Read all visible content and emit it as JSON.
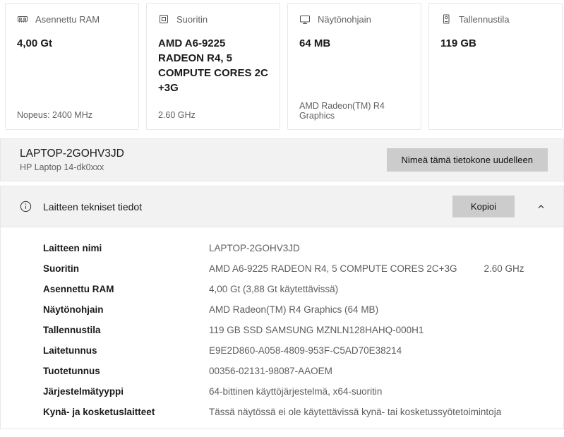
{
  "cards": [
    {
      "icon": "ram-icon",
      "label": "Asennettu RAM",
      "value": "4,00 Gt",
      "footer": "Nopeus: 2400 MHz"
    },
    {
      "icon": "cpu-icon",
      "label": "Suoritin",
      "value": "AMD A6-9225 RADEON R4, 5 COMPUTE CORES 2C +3G",
      "footer": "2.60 GHz"
    },
    {
      "icon": "gpu-icon",
      "label": "Näytönohjain",
      "value": "64 MB",
      "footer": "AMD Radeon(TM) R4 Graphics"
    },
    {
      "icon": "storage-icon",
      "label": "Tallennustila",
      "value": "119 GB",
      "footer": ""
    }
  ],
  "device": {
    "name": "LAPTOP-2GOHV3JD",
    "model": "HP Laptop 14-dk0xxx",
    "rename_button": "Nimeä tämä tietokone uudelleen"
  },
  "specs": {
    "title": "Laitteen tekniset tiedot",
    "copy_button": "Kopioi",
    "rows": [
      {
        "label": "Laitteen nimi",
        "value": "LAPTOP-2GOHV3JD"
      },
      {
        "label": "Suoritin",
        "value": "AMD A6-9225 RADEON R4, 5 COMPUTE CORES 2C+3G",
        "value2": "2.60 GHz"
      },
      {
        "label": "Asennettu RAM",
        "value": "4,00 Gt (3,88 Gt käytettävissä)"
      },
      {
        "label": "Näytönohjain",
        "value": "AMD Radeon(TM) R4 Graphics (64 MB)"
      },
      {
        "label": "Tallennustila",
        "value": "119 GB SSD SAMSUNG MZNLN128HAHQ-000H1"
      },
      {
        "label": "Laitetunnus",
        "value": "E9E2D860-A058-4809-953F-C5AD70E38214"
      },
      {
        "label": "Tuotetunnus",
        "value": "00356-02131-98087-AAOEM"
      },
      {
        "label": "Järjestelmätyyppi",
        "value": "64-bittinen käyttöjärjestelmä, x64-suoritin"
      },
      {
        "label": "Kynä- ja kosketuslaitteet",
        "value": "Tässä näytössä ei ole käytettävissä kynä- tai kosketussyötetoimintoja"
      }
    ]
  },
  "colors": {
    "button-bg": "#cccccc",
    "bar-bg": "#f2f2f2",
    "card-border": "#e7e7e7",
    "text-dark": "#1a1a1a",
    "text-gray": "#616161"
  }
}
